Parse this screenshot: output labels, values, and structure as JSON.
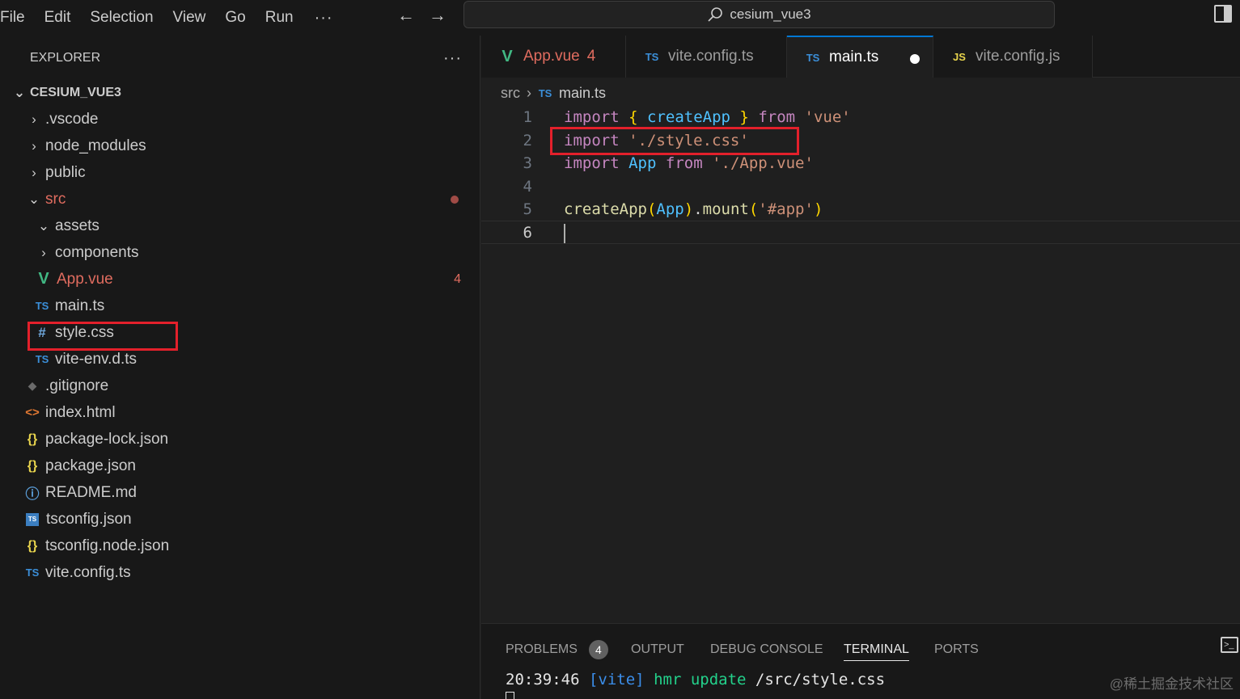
{
  "menu": {
    "file": "File",
    "edit": "Edit",
    "selection": "Selection",
    "view": "View",
    "go": "Go",
    "run": "Run",
    "more": "···"
  },
  "nav": {
    "back": "←",
    "forward": "→"
  },
  "command_center": {
    "title": "cesium_vue3",
    "icon": "search-icon"
  },
  "sidebar": {
    "title": "EXPLORER",
    "more": "···",
    "root": "CESIUM_VUE3",
    "items": [
      {
        "label": ".vscode",
        "type": "folder",
        "expanded": false
      },
      {
        "label": "node_modules",
        "type": "folder",
        "expanded": false
      },
      {
        "label": "public",
        "type": "folder",
        "expanded": false
      },
      {
        "label": "src",
        "type": "folder",
        "expanded": true,
        "modified": true
      },
      {
        "label": "assets",
        "type": "folder",
        "expanded": true
      },
      {
        "label": "components",
        "type": "folder",
        "expanded": false
      },
      {
        "label": "App.vue",
        "type": "vue",
        "badge": "4"
      },
      {
        "label": "main.ts",
        "type": "ts"
      },
      {
        "label": "style.css",
        "type": "css",
        "highlighted": true
      },
      {
        "label": "vite-env.d.ts",
        "type": "ts"
      },
      {
        "label": ".gitignore",
        "type": "git"
      },
      {
        "label": "index.html",
        "type": "html"
      },
      {
        "label": "package-lock.json",
        "type": "json"
      },
      {
        "label": "package.json",
        "type": "json"
      },
      {
        "label": "README.md",
        "type": "info"
      },
      {
        "label": "tsconfig.json",
        "type": "tsconfig"
      },
      {
        "label": "tsconfig.node.json",
        "type": "json"
      },
      {
        "label": "vite.config.ts",
        "type": "ts"
      }
    ]
  },
  "icons": {
    "ts": "TS",
    "js": "JS",
    "vue": "V",
    "css": "#",
    "json": "{}",
    "html": "<>",
    "git": "◆",
    "info": "ⓘ",
    "tsconfig": "TS"
  },
  "tabs": [
    {
      "label": "App.vue",
      "type": "vue",
      "badge": "4",
      "active": false
    },
    {
      "label": "vite.config.ts",
      "type": "ts",
      "active": false
    },
    {
      "label": "main.ts",
      "type": "ts",
      "active": true,
      "dirty": true
    },
    {
      "label": "vite.config.js",
      "type": "js",
      "active": false
    }
  ],
  "breadcrumb": {
    "folder": "src",
    "file": "main.ts"
  },
  "code": {
    "line_numbers": [
      "1",
      "2",
      "3",
      "4",
      "5",
      "6"
    ],
    "l1": {
      "import": "import",
      "open": "{",
      "name": "createApp",
      "close": "}",
      "from": "from",
      "source": "'vue'"
    },
    "l2": {
      "import": "import",
      "source": "'./style.css'"
    },
    "l3": {
      "import": "import",
      "name": "App",
      "from": "from",
      "source": "'./App.vue'"
    },
    "l5": {
      "fn": "createApp",
      "open": "(",
      "arg": "App",
      "close": ")",
      "dot": ".",
      "method": "mount",
      "open2": "(",
      "source": "'#app'",
      "close2": ")"
    }
  },
  "panel": {
    "problems": "PROBLEMS",
    "problems_count": "4",
    "output": "OUTPUT",
    "debug_console": "DEBUG CONSOLE",
    "terminal": "TERMINAL",
    "ports": "PORTS",
    "terminal_line": {
      "time": "20:39:46",
      "tag": "[vite]",
      "event": "hmr update",
      "path": "/src/style.css"
    }
  },
  "watermark": "@稀土掘金技术社区",
  "colors": {
    "accent": "#0078d4",
    "highlight_box": "#e3202b",
    "modified": "#e06c5f"
  }
}
